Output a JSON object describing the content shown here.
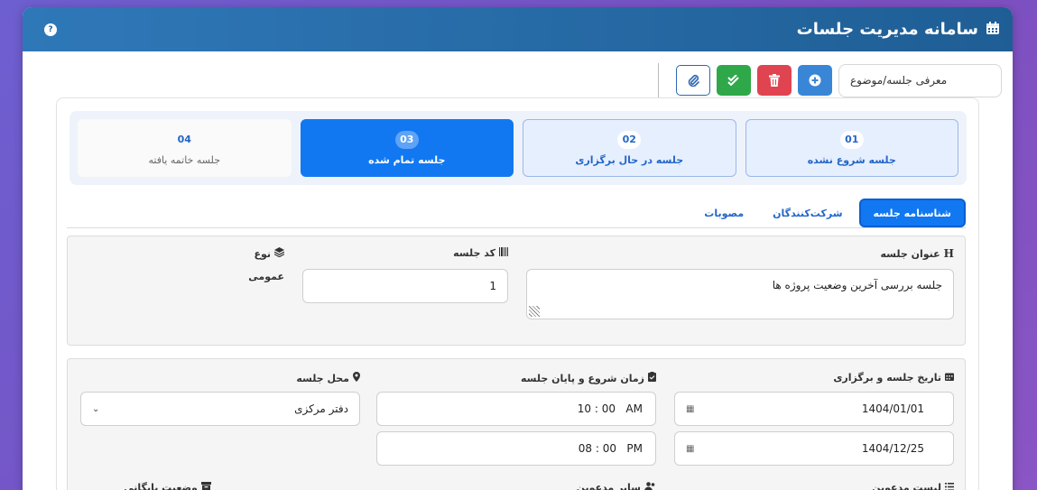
{
  "header": {
    "title": "سامانه مدیریت جلسات",
    "help_label": "?"
  },
  "toolbar": {
    "topic_value": "معرفی جلسه/موضوع"
  },
  "steps": [
    {
      "num": "01",
      "label": "جلسه شروع نشده",
      "state": "pending"
    },
    {
      "num": "02",
      "label": "جلسه در حال برگزاری",
      "state": "pending"
    },
    {
      "num": "03",
      "label": "جلسه تمام شده",
      "state": "active"
    },
    {
      "num": "04",
      "label": "جلسه خاتمه یافته",
      "state": "idle"
    }
  ],
  "tabs": [
    {
      "label": "شناسنامه جلسه",
      "active": true
    },
    {
      "label": "شرکت‌کنندگان",
      "active": false
    },
    {
      "label": "مصوبات",
      "active": false
    }
  ],
  "info": {
    "title_label": "عنوان جلسه",
    "title_value": "جلسه بررسی آخرین وضعیت پروژه ها",
    "code_label": "کد جلسه",
    "code_value": "1",
    "type_label": "نوع",
    "type_value": "عمومی"
  },
  "schedule": {
    "date_label": "تاریخ جلسه و برگزاری",
    "start_date": "1404/01/01",
    "end_date": "1404/12/25",
    "time_label": "زمان شروع و پایان جلسه",
    "start_time": "10 : 00   AM",
    "end_time": "08 : 00   PM",
    "place_label": "محل جلسه",
    "place_value": "دفتر مرکزی",
    "invitees_label": "لیست مدعوین",
    "other_invitees_label": "سایر مدعوین",
    "archive_label": "وضعیت بایگانی"
  },
  "colors": {
    "primary": "#1178f2",
    "header": "#1f5e95",
    "danger": "#e04450",
    "success": "#2fa84a"
  }
}
